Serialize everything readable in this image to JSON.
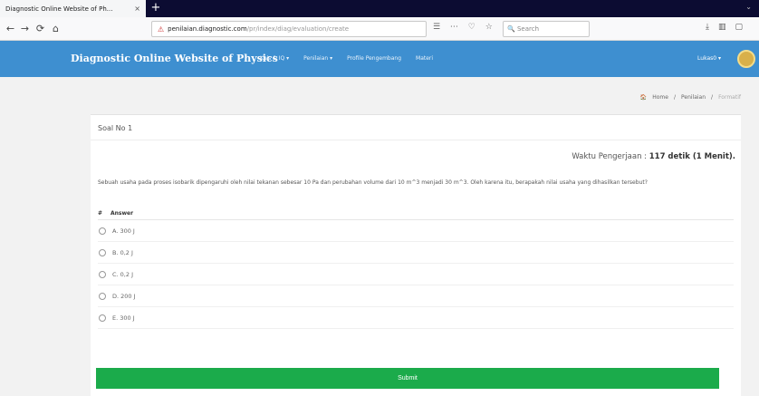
{
  "browser": {
    "tab_title": "Diagnostic Online Website of Ph...",
    "tab_close": "×",
    "new_tab": "+",
    "url_domain": "penilaian.diagnostic.com",
    "url_path": "/pr/index/diag/evaluation/create",
    "search_placeholder": "Search",
    "back": "←",
    "forward": "→",
    "reload": "⟳",
    "home": "⌂"
  },
  "navbar": {
    "brand": "Diagnostic Online Website of Physics",
    "links": [
      "Kuis & IQ ▾",
      "Penilaian ▾",
      "Profile Pengembang",
      "Materi"
    ],
    "user": "Lukas0 ▾"
  },
  "breadcrumb": {
    "home": "Home",
    "section": "Penilaian",
    "current": "Formatif"
  },
  "card": {
    "title": "Soal No 1",
    "timer_label": "Waktu Pengerjaan : ",
    "timer_value": "117 detik (1 Menit).",
    "question": "Sebuah usaha pada proses isobarik dipengaruhi oleh nilai tekanan sebesar 10 Pa dan perubahan volume dari 10 m^3 menjadi 30 m^3. Oleh karena itu, berapakah nilai usaha yang dihasilkan tersebut?",
    "answer_header_hash": "#",
    "answer_header": "Answer",
    "answers": [
      "A. 300 J",
      "B. 0,2 J",
      "C. 0,2 J",
      "D. 200 J",
      "E. 300 J"
    ],
    "submit": "Submit"
  },
  "colors": {
    "navbar": "#3e8fd0",
    "submit": "#1bab4b",
    "tabbar": "#0c0c32"
  }
}
